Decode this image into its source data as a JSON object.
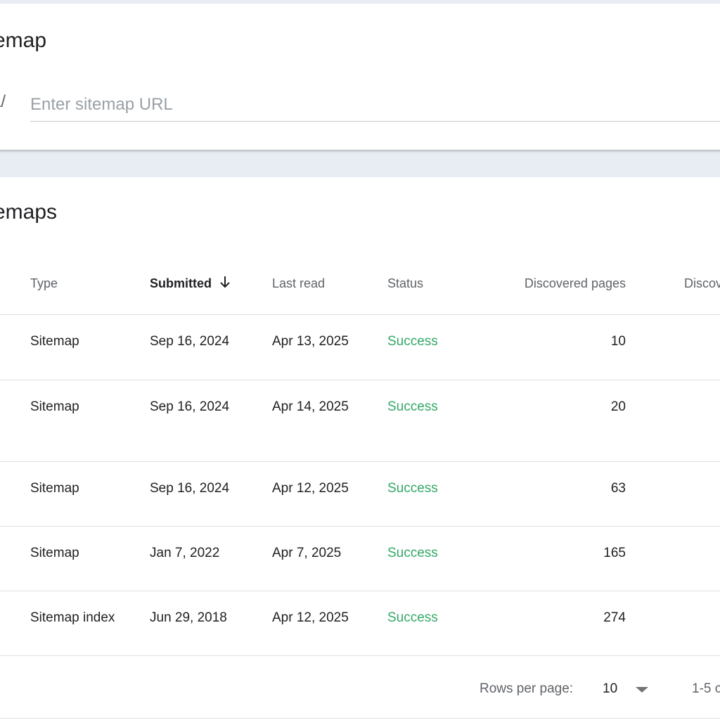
{
  "add_card": {
    "title": "itemap",
    "url_prefix": "ca/",
    "input_placeholder": "Enter sitemap URL",
    "input_value": ""
  },
  "list_card": {
    "title": "itemaps",
    "columns": {
      "type": "Type",
      "submitted": "Submitted",
      "last_read": "Last read",
      "status": "Status",
      "discovered_pages": "Discovered pages",
      "discovered_videos": "Discov"
    },
    "sort_icon": "arrow-down-icon",
    "rows": [
      {
        "type": "Sitemap",
        "submitted": "Sep 16, 2024",
        "last_read": "Apr 13, 2025",
        "status": "Success",
        "discovered_pages": "10"
      },
      {
        "type": "Sitemap",
        "submitted": "Sep 16, 2024",
        "last_read": "Apr 14, 2025",
        "status": "Success",
        "discovered_pages": "20"
      },
      {
        "type": "Sitemap",
        "submitted": "Sep 16, 2024",
        "last_read": "Apr 12, 2025",
        "status": "Success",
        "discovered_pages": "63"
      },
      {
        "type": "Sitemap",
        "submitted": "Jan 7, 2022",
        "last_read": "Apr 7, 2025",
        "status": "Success",
        "discovered_pages": "165"
      },
      {
        "type": "Sitemap index",
        "submitted": "Jun 29, 2018",
        "last_read": "Apr 12, 2025",
        "status": "Success",
        "discovered_pages": "274"
      }
    ],
    "pagination": {
      "rows_per_page_label": "Rows per page:",
      "rows_per_page_value": "10",
      "range_text": "1-5 c"
    }
  },
  "colors": {
    "success": "#34a868",
    "page_background": "#e8edf3",
    "card_background": "#ffffff"
  }
}
